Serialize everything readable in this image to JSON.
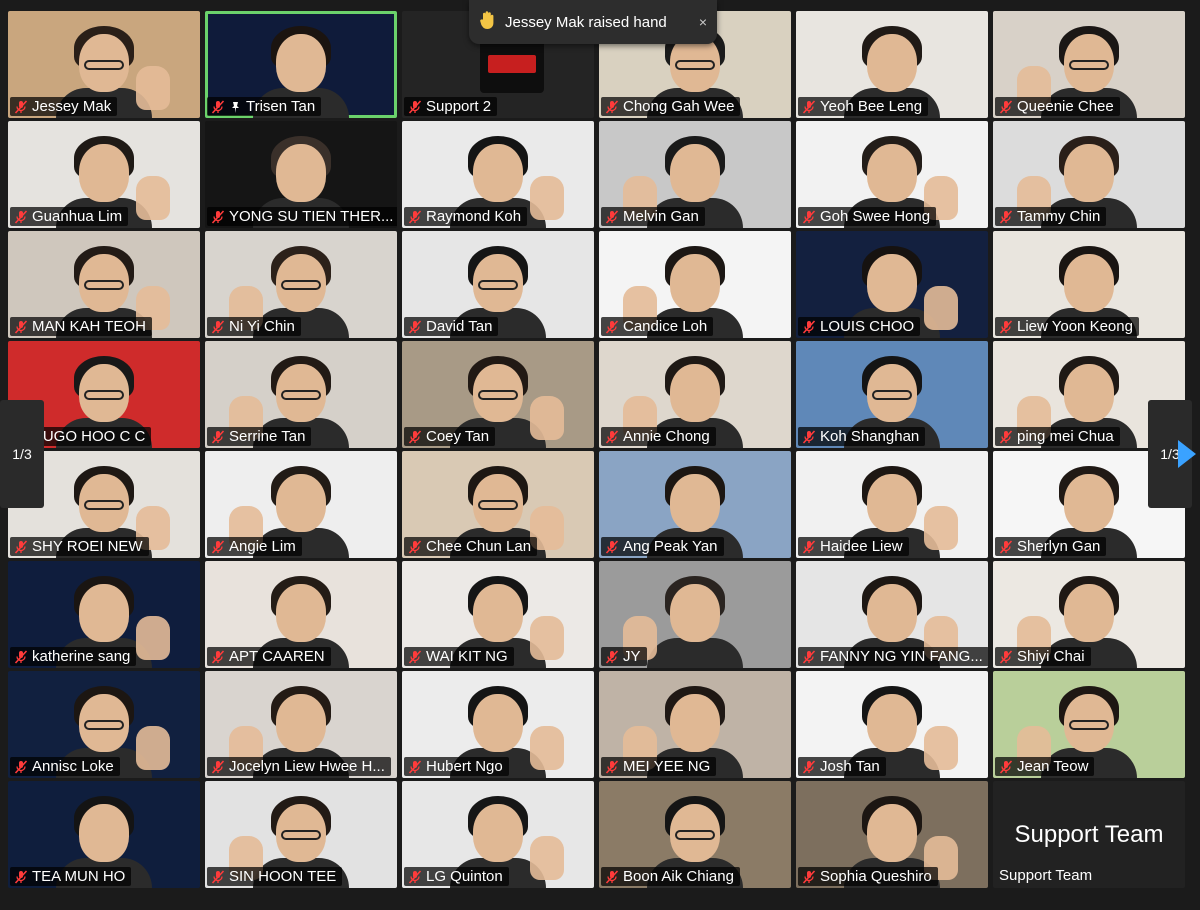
{
  "notification": {
    "icon": "raised-hand-icon",
    "text": "Jessey Mak raised hand",
    "close": "×"
  },
  "pager": {
    "label_left": "1/3",
    "label_right": "1/3"
  },
  "colors": {
    "active_speaker_border": "#6bd26b",
    "next_arrow": "#3aa2ff",
    "muted_mic": "#ff3b3b"
  },
  "tiles": [
    {
      "name": "Jessey Mak",
      "bg": "#c9a67e",
      "hair": "#2a1f18",
      "glasses": true,
      "hand": true
    },
    {
      "name": "Trisen Tan",
      "bg": "#0f1b3a",
      "hair": "#1b1410",
      "pinned": true,
      "active": true
    },
    {
      "name": "Support 2",
      "bg": "#242424",
      "logo": true
    },
    {
      "name": "Chong Gah Wee",
      "bg": "#d9d1c0",
      "hair": "#1b1b1b",
      "glasses": true
    },
    {
      "name": "Yeoh Bee Leng",
      "bg": "#e8e5e0",
      "hair": "#201a16"
    },
    {
      "name": "Queenie Chee",
      "bg": "#d8d1c8",
      "hair": "#1b1715",
      "glasses": true,
      "hand": true
    },
    {
      "name": "Guanhua Lim",
      "bg": "#e5e3df",
      "hair": "#1f1a16",
      "hand": true
    },
    {
      "name": "YONG SU TIEN THER...",
      "bg": "#151515",
      "hair": "#3a302a"
    },
    {
      "name": "Raymond Koh",
      "bg": "#eaeaea",
      "hair": "#141414",
      "hand": true
    },
    {
      "name": "Melvin Gan",
      "bg": "#c8c8c8",
      "hair": "#1a1a1a",
      "hand": true
    },
    {
      "name": "Goh Swee Hong",
      "bg": "#f2f2f2",
      "hair": "#231d19",
      "hand": true
    },
    {
      "name": "Tammy Chin",
      "bg": "#dcdcdc",
      "hair": "#2a1f19",
      "hand": true
    },
    {
      "name": "MAN KAH TEOH",
      "bg": "#cfc7bd",
      "hair": "#231b16",
      "glasses": true,
      "hand": true
    },
    {
      "name": "Ni Yi Chin",
      "bg": "#d8d4ce",
      "hair": "#2c211a",
      "glasses": true,
      "hand": true
    },
    {
      "name": "David Tan",
      "bg": "#e6e6e6",
      "hair": "#151515",
      "glasses": true
    },
    {
      "name": "Candice Loh",
      "bg": "#f4f4f4",
      "hair": "#1c1714",
      "hand": true
    },
    {
      "name": "LOUIS CHOO",
      "bg": "#13203f",
      "hair": "#161210",
      "hand": true
    },
    {
      "name": "Liew Yoon Keong",
      "bg": "#e9e5de",
      "hair": "#1a1512"
    },
    {
      "name": "HUGO HOO C C",
      "bg": "#cf2b2b",
      "hair": "#181818",
      "glasses": true
    },
    {
      "name": "Serrine Tan",
      "bg": "#d5d0c9",
      "hair": "#221a15",
      "glasses": true,
      "hand": true
    },
    {
      "name": "Coey Tan",
      "bg": "#a89a86",
      "hair": "#211914",
      "glasses": true,
      "hand": true
    },
    {
      "name": "Annie Chong",
      "bg": "#ded7cd",
      "hair": "#1f1915",
      "hand": true
    },
    {
      "name": "Koh Shanghan",
      "bg": "#5f88b8",
      "hair": "#141414",
      "glasses": true
    },
    {
      "name": "ping mei Chua",
      "bg": "#e9e4dd",
      "hair": "#1f1915",
      "hand": true
    },
    {
      "name": "SHY ROEI NEW",
      "bg": "#e4e1dc",
      "hair": "#1e1814",
      "glasses": true,
      "hand": true
    },
    {
      "name": "Angie Lim",
      "bg": "#eeeeee",
      "hair": "#221b16",
      "hand": true
    },
    {
      "name": "Chee Chun Lan",
      "bg": "#d9c9b4",
      "hair": "#1d1713",
      "glasses": true,
      "hand": true
    },
    {
      "name": "Ang Peak Yan",
      "bg": "#8aa4c4",
      "hair": "#1c1612"
    },
    {
      "name": "Haidee Liew",
      "bg": "#f1f1f1",
      "hair": "#1d1713",
      "hand": true
    },
    {
      "name": "Sherlyn Gan",
      "bg": "#f6f6f6",
      "hair": "#201915"
    },
    {
      "name": "katherine sang",
      "bg": "#0f1d3d",
      "hair": "#1a1512",
      "hand": true
    },
    {
      "name": "APT CAAREN",
      "bg": "#e8e2dc",
      "hair": "#241c16"
    },
    {
      "name": "WAI KIT NG",
      "bg": "#ece9e6",
      "hair": "#151515",
      "hand": true
    },
    {
      "name": "JY",
      "bg": "#9b9b9b",
      "hair": "#2a2420",
      "hand": true
    },
    {
      "name": "FANNY NG YIN FANG...",
      "bg": "#e5e5e5",
      "hair": "#1d1713",
      "hand": true
    },
    {
      "name": "Shiyi Chai",
      "bg": "#ece8e2",
      "hair": "#1f1814",
      "hand": true
    },
    {
      "name": "Annisc Loke",
      "bg": "#11203f",
      "hair": "#1c1612",
      "glasses": true,
      "hand": true
    },
    {
      "name": "Jocelyn Liew Hwee H...",
      "bg": "#d9d4cf",
      "hair": "#241b15",
      "hand": true
    },
    {
      "name": "Hubert Ngo",
      "bg": "#ececec",
      "hair": "#141414",
      "hand": true
    },
    {
      "name": "MEI YEE NG",
      "bg": "#bfb3a6",
      "hair": "#1f1814",
      "hand": true
    },
    {
      "name": "Josh Tan",
      "bg": "#f3f3f3",
      "hair": "#151515",
      "hand": true
    },
    {
      "name": "Jean Teow",
      "bg": "#b9cf9a",
      "hair": "#1e1713",
      "glasses": true,
      "hand": true
    },
    {
      "name": "TEA MUN HO",
      "bg": "#0f1e3d",
      "hair": "#141414"
    },
    {
      "name": "SIN HOON TEE",
      "bg": "#e2e2e2",
      "hair": "#221a15",
      "glasses": true,
      "hand": true
    },
    {
      "name": "LG Quinton",
      "bg": "#e7e7e7",
      "hair": "#161616",
      "hand": true
    },
    {
      "name": "Boon Aik Chiang",
      "bg": "#8b7b66",
      "hair": "#151515",
      "glasses": true
    },
    {
      "name": "Sophia Queshiro",
      "bg": "#7d6f5e",
      "hair": "#1c1612",
      "hand": true
    },
    {
      "name": "Support Team",
      "bg": "#222222",
      "support": true,
      "big_label": "Support Team"
    }
  ]
}
